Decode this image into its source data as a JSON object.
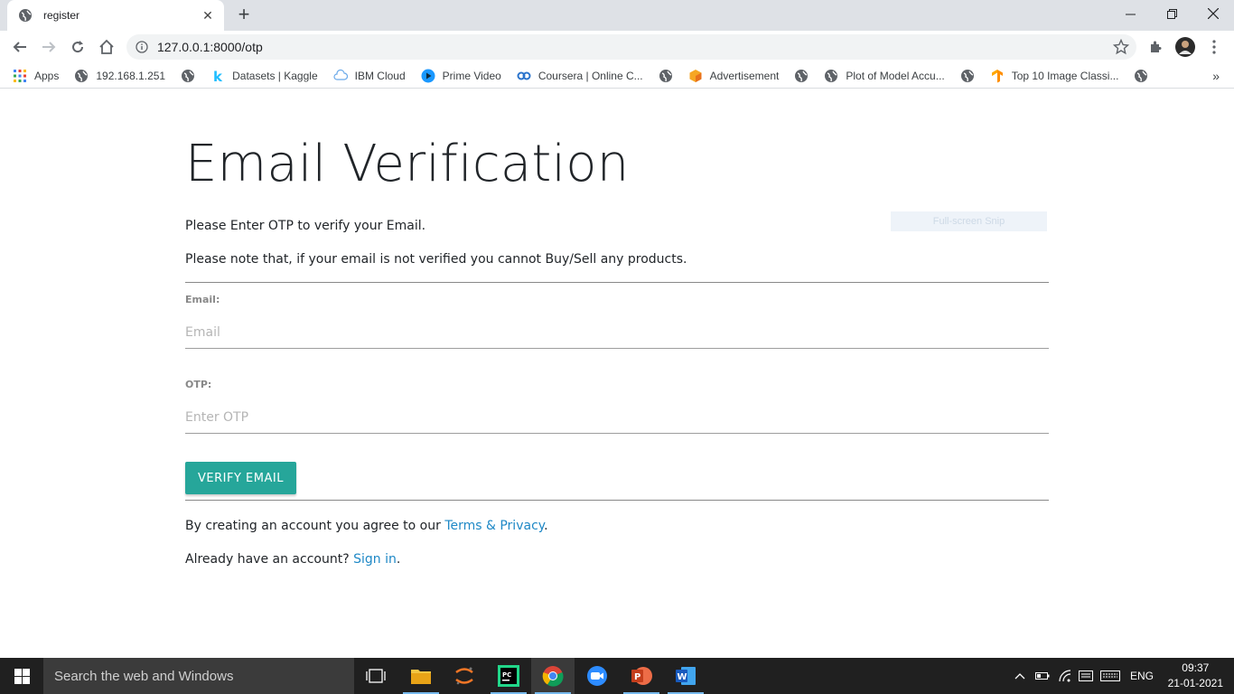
{
  "browser": {
    "tab_title": "register",
    "url": "127.0.0.1:8000/otp",
    "bookmarks": [
      {
        "label": "Apps",
        "icon": "apps-grid-icon"
      },
      {
        "label": "192.168.1.251",
        "icon": "globe-icon"
      },
      {
        "label": "",
        "icon": "globe-icon"
      },
      {
        "label": "Datasets | Kaggle",
        "icon": "kaggle-icon"
      },
      {
        "label": "IBM Cloud",
        "icon": "cloud-icon"
      },
      {
        "label": "Prime Video",
        "icon": "prime-video-icon"
      },
      {
        "label": "Coursera | Online C...",
        "icon": "coursera-icon"
      },
      {
        "label": "",
        "icon": "globe-icon"
      },
      {
        "label": "Advertisement",
        "icon": "cube-icon"
      },
      {
        "label": "",
        "icon": "globe-icon"
      },
      {
        "label": "Plot of Model Accu...",
        "icon": "globe-icon"
      },
      {
        "label": "",
        "icon": "globe-icon"
      },
      {
        "label": "Top 10 Image Classi...",
        "icon": "tf-icon"
      },
      {
        "label": "",
        "icon": "globe-icon"
      }
    ],
    "more_label": "»"
  },
  "page": {
    "title": "Email Verification",
    "intro": "Please Enter OTP to verify your Email.",
    "note": "Please note that, if your email is not verified you cannot Buy/Sell any products.",
    "email_label": "Email:",
    "email_placeholder": "Email",
    "otp_label": "OTP:",
    "otp_placeholder": "Enter OTP",
    "verify_button": "VERIFY EMAIL",
    "terms_prefix": "By creating an account you agree to our ",
    "terms_link": "Terms & Privacy",
    "terms_suffix": ".",
    "signin_prefix": "Already have an account? ",
    "signin_link": "Sign in",
    "signin_suffix": ".",
    "snip_overlay": "Full-screen Snip"
  },
  "taskbar": {
    "search_placeholder": "Search the web and Windows",
    "language": "ENG",
    "time": "09:37",
    "date": "21-01-2021"
  },
  "colors": {
    "accent_button": "#26a69a",
    "link": "#1e88c6"
  }
}
